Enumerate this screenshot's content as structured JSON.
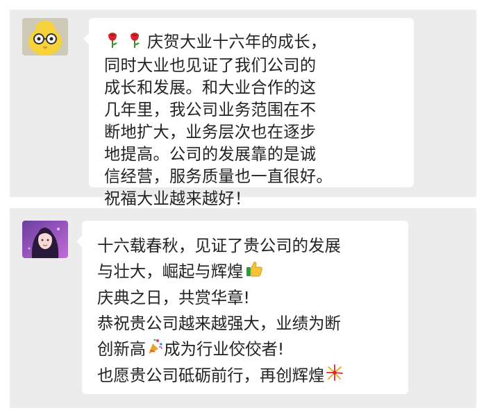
{
  "messages": [
    {
      "avatar_icon": "yellow-chick-avatar",
      "lines": [
        "庆贺大业十六年的成长，",
        "同时大业也见证了我们公司的",
        "成长和发展。和大业合作的这",
        "几年里，我公司业务范围在不",
        "断地扩大，业务层次也在逐步",
        "地提高。公司的发展靠的是诚",
        "信经营，服务质量也一直很好。",
        "祝福大业越来越好！"
      ],
      "leading_emoji": [
        "rose-emoji",
        "rose-emoji"
      ]
    },
    {
      "avatar_icon": "girl-portrait-avatar",
      "lines": [
        "十六载春秋，见证了贵公司的发展",
        "与壮大，崛起与辉煌",
        "庆典之日，共赏华章!",
        "恭祝贵公司越来越强大，业绩为断",
        "创新高",
        "成为行业佼佼者!",
        "也愿贵公司砥砺前行，再创辉煌"
      ],
      "inline_emoji": [
        "thumbs-up-emoji",
        "party-popper-emoji",
        "fireworks-emoji"
      ]
    }
  ],
  "colors": {
    "panel_bg": "#ececec",
    "bubble_bg": "#ffffff",
    "text": "#222222"
  }
}
